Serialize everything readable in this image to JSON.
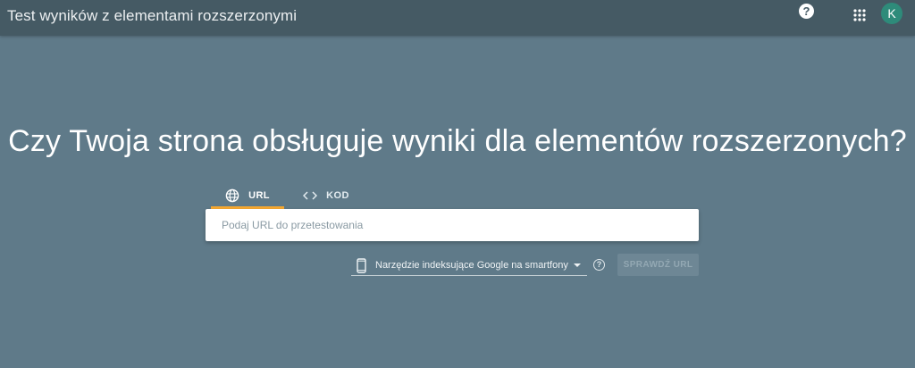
{
  "topbar": {
    "title": "Test wyników z elementami rozszerzonymi",
    "help_icon": "help-circle-icon",
    "help_glyph": "?",
    "apps_icon": "apps-grid-icon",
    "avatar_letter": "K",
    "avatar_color": "#2e8b7a"
  },
  "main": {
    "headline": "Czy Twoja strona obsługuje wyniki dla elementów rozszerzonych?",
    "tabs": [
      {
        "label": "URL",
        "icon": "globe-icon",
        "active": true
      },
      {
        "label": "KOD",
        "icon": "code-icon",
        "active": false
      }
    ],
    "url_input": {
      "placeholder": "Podaj URL do przetestowania",
      "value": ""
    },
    "device_select": {
      "icon": "smartphone-icon",
      "selected": "Narzędzie indeksujące Google na smartfony"
    },
    "help_small_glyph": "?",
    "check_button_label": "SPRAWDŹ URL"
  },
  "colors": {
    "background": "#5f7a89",
    "topbar": "#455a64",
    "accent_tab": "#f6a830"
  }
}
